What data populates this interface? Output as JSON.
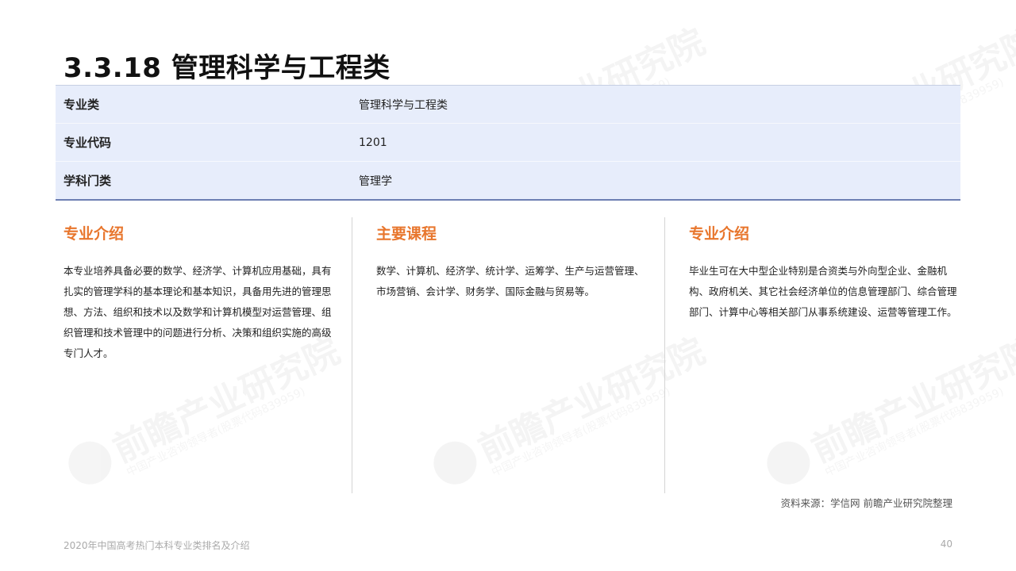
{
  "title": "3.3.18 管理科学与工程类",
  "watermark": {
    "text": "前瞻产业研究院",
    "subtext": "中国产业咨询领导者(股票代码839959)"
  },
  "table": {
    "rows": [
      {
        "label": "专业类",
        "value": "管理科学与工程类"
      },
      {
        "label": "专业代码",
        "value": "1201"
      },
      {
        "label": "学科门类",
        "value": "管理学"
      }
    ]
  },
  "columns": [
    {
      "heading": "专业介绍",
      "body": "本专业培养具备必要的数学、经济学、计算机应用基础，具有扎实的管理学科的基本理论和基本知识，具备用先进的管理思想、方法、组织和技术以及数学和计算机模型对运营管理、组织管理和技术管理中的问题进行分析、决策和组织实施的高级专门人才。"
    },
    {
      "heading": "主要课程",
      "body": "数学、计算机、经济学、统计学、运筹学、生产与运营管理、市场营销、会计学、财务学、国际金融与贸易等。"
    },
    {
      "heading": "专业介绍",
      "body": "毕业生可在大中型企业特别是合资类与外向型企业、金融机构、政府机关、其它社会经济单位的信息管理部门、综合管理部门、计算中心等相关部门从事系统建设、运营等管理工作。"
    }
  ],
  "source": "资料来源：学信网 前瞻产业研究院整理",
  "footer": {
    "document_title": "2020年中国高考热门本科专业类排名及介绍",
    "page_number": "40"
  },
  "colors": {
    "accent": "#e8762d",
    "table_bg": "#e7edfb",
    "table_border": "#6d7fb3"
  }
}
